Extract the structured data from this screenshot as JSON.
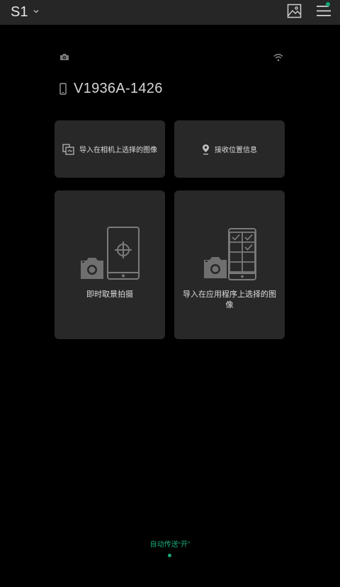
{
  "header": {
    "camera_name": "S1",
    "gallery_icon": "gallery-icon",
    "menu_icon": "menu-icon",
    "menu_badge_color": "#13a87a"
  },
  "status": {
    "camera_icon": "camera-status-icon",
    "wifi_icon": "wifi-icon"
  },
  "device": {
    "icon": "phone-icon",
    "name": "V1936A-1426"
  },
  "cards": {
    "import_camera": "导入在相机上选择的图像",
    "receive_location": "接收位置信息",
    "live_view": "即时取景拍摄",
    "import_app": "导入在应用程序上选择的图像"
  },
  "footer": {
    "auto_transfer": "自动传送“开”",
    "accent_color": "#19a97c"
  }
}
